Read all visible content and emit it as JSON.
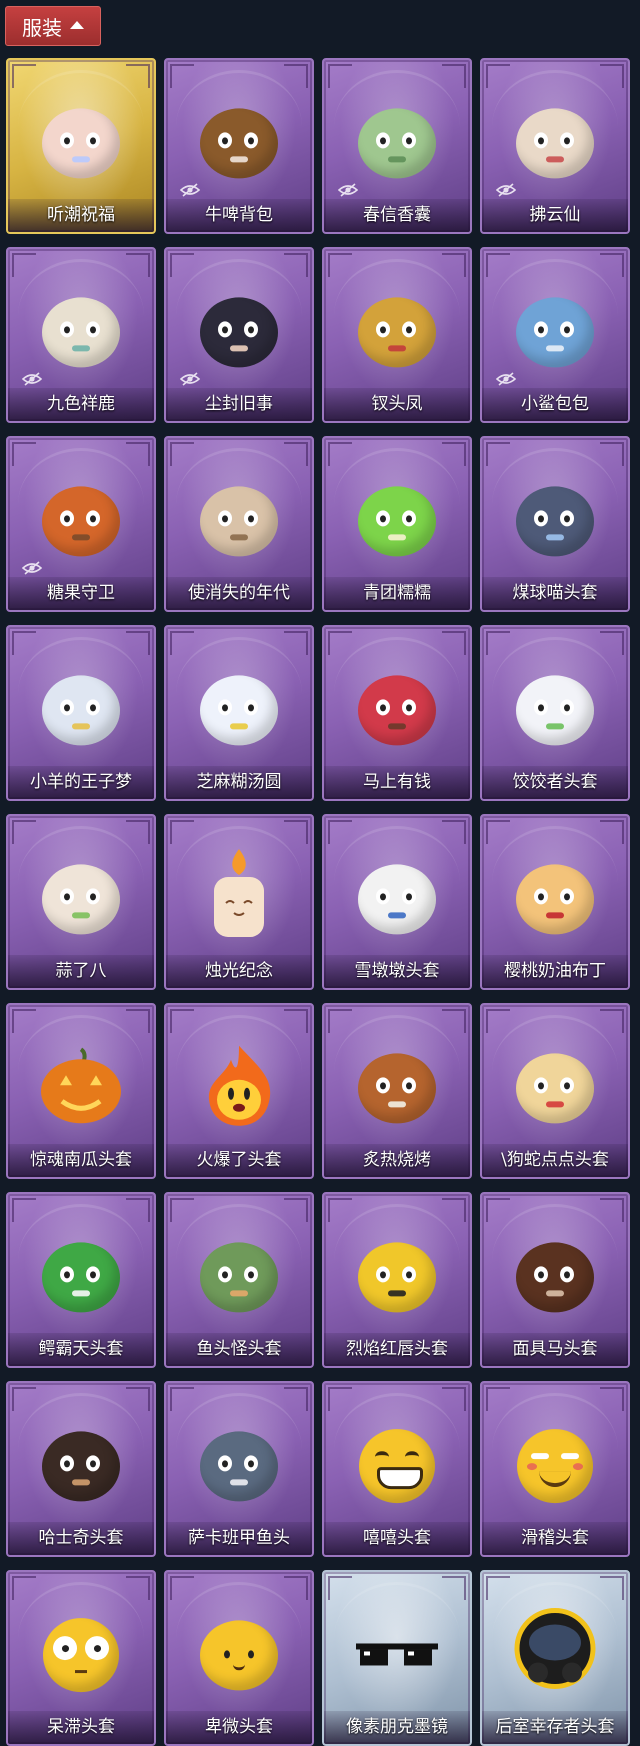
{
  "header": {
    "label": "服装"
  },
  "items": [
    {
      "name": "听潮祝福",
      "frame": "gold",
      "hidden": false,
      "icon": "bust-icon",
      "color": "#f3d6cc",
      "accent": "#b7c9ff"
    },
    {
      "name": "牛啤背包",
      "frame": "purple",
      "hidden": true,
      "icon": "cow-barrel-icon",
      "color": "#8a5a2b",
      "accent": "#f1e4dc"
    },
    {
      "name": "春信香囊",
      "frame": "purple",
      "hidden": true,
      "icon": "sachet-icon",
      "color": "#9fc78f",
      "accent": "#5e8f58"
    },
    {
      "name": "拂云仙",
      "frame": "purple",
      "hidden": true,
      "icon": "fairy-charm-icon",
      "color": "#e9d9c8",
      "accent": "#c94f4f"
    },
    {
      "name": "九色祥鹿",
      "frame": "purple",
      "hidden": true,
      "icon": "deer-icon",
      "color": "#e8e0d0",
      "accent": "#6fb3a8"
    },
    {
      "name": "尘封旧事",
      "frame": "purple",
      "hidden": true,
      "icon": "doll-icon",
      "color": "#2c2a3a",
      "accent": "#f0d2c0"
    },
    {
      "name": "钗头凤",
      "frame": "purple",
      "hidden": false,
      "icon": "phoenix-crown-icon",
      "color": "#d3a23a",
      "accent": "#c23b3b"
    },
    {
      "name": "小鲨包包",
      "frame": "purple",
      "hidden": true,
      "icon": "shark-icon",
      "color": "#6fa3d6",
      "accent": "#e9f0f7"
    },
    {
      "name": "糖果守卫",
      "frame": "purple",
      "hidden": true,
      "icon": "scarecrow-icon",
      "color": "#d4662a",
      "accent": "#7a4a2a"
    },
    {
      "name": "使消失的年代",
      "frame": "purple",
      "hidden": false,
      "icon": "portrait-icon",
      "color": "#d9c2a8",
      "accent": "#8a6a4a"
    },
    {
      "name": "青团糯糯",
      "frame": "purple",
      "hidden": false,
      "icon": "green-blob-icon",
      "color": "#7dd44a",
      "accent": "#f7f2d0"
    },
    {
      "name": "煤球喵头套",
      "frame": "purple",
      "hidden": false,
      "icon": "cat-head-icon",
      "color": "#4e5a78",
      "accent": "#9fc3f0"
    },
    {
      "name": "小羊的王子梦",
      "frame": "purple",
      "hidden": false,
      "icon": "sheep-icon",
      "color": "#dfe6f2",
      "accent": "#e5c04a"
    },
    {
      "name": "芝麻糊汤圆",
      "frame": "purple",
      "hidden": false,
      "icon": "dumpling-icon",
      "color": "#eef2fb",
      "accent": "#e8c93a"
    },
    {
      "name": "马上有钱",
      "frame": "purple",
      "hidden": false,
      "icon": "horse-head-icon",
      "color": "#d23a4a",
      "accent": "#6a3a2a"
    },
    {
      "name": "饺饺者头套",
      "frame": "purple",
      "hidden": false,
      "icon": "cloud-head-icon",
      "color": "#f2f3f8",
      "accent": "#6bbf5a"
    },
    {
      "name": "蒜了八",
      "frame": "purple",
      "hidden": false,
      "icon": "garlic-icon",
      "color": "#efe4d8",
      "accent": "#7cbf5a"
    },
    {
      "name": "烛光纪念",
      "frame": "purple",
      "hidden": false,
      "icon": "candle-icon",
      "color": "#f6e2cc",
      "accent": "#f59a2a"
    },
    {
      "name": "雪墩墩头套",
      "frame": "purple",
      "hidden": false,
      "icon": "snowman-icon",
      "color": "#f2f2f2",
      "accent": "#3a6ac2"
    },
    {
      "name": "樱桃奶油布丁",
      "frame": "purple",
      "hidden": false,
      "icon": "pudding-icon",
      "color": "#f3c37a",
      "accent": "#c2272d"
    },
    {
      "name": "惊魂南瓜头套",
      "frame": "purple",
      "hidden": false,
      "icon": "pumpkin-icon",
      "color": "#e67a1a",
      "accent": "#ffd65a"
    },
    {
      "name": "火爆了头套",
      "frame": "purple",
      "hidden": false,
      "icon": "fire-icon",
      "color": "#f26a1b",
      "accent": "#ffcf3a"
    },
    {
      "name": "炙热烧烤",
      "frame": "purple",
      "hidden": false,
      "icon": "bbq-icon",
      "color": "#b5642e",
      "accent": "#f2efe6"
    },
    {
      "name": "\\狗蛇点点头套",
      "frame": "purple",
      "hidden": false,
      "icon": "dog-snake-icon",
      "color": "#f0d59a",
      "accent": "#d43a3a"
    },
    {
      "name": "鳄霸天头套",
      "frame": "purple",
      "hidden": false,
      "icon": "crocodile-icon",
      "color": "#3fa845",
      "accent": "#f7f7f7"
    },
    {
      "name": "鱼头怪头套",
      "frame": "purple",
      "hidden": false,
      "icon": "fish-mask-icon",
      "color": "#6f9a5a",
      "accent": "#e7a86a"
    },
    {
      "name": "烈焰红唇头套",
      "frame": "purple",
      "hidden": false,
      "icon": "pikachu-icon",
      "color": "#f0c72a",
      "accent": "#222222"
    },
    {
      "name": "面具马头套",
      "frame": "purple",
      "hidden": false,
      "icon": "horse-mask-icon",
      "color": "#5a3220",
      "accent": "#d9c0a8"
    },
    {
      "name": "哈士奇头套",
      "frame": "purple",
      "hidden": false,
      "icon": "husky-icon",
      "color": "#3a2a24",
      "accent": "#d4a070"
    },
    {
      "name": "萨卡班甲鱼头",
      "frame": "purple",
      "hidden": false,
      "icon": "fish-icon",
      "color": "#5a6a80",
      "accent": "#eef0f4"
    },
    {
      "name": "嘻嘻头套",
      "frame": "purple",
      "hidden": false,
      "icon": "grin-emoji-icon",
      "color": "#f6c52a",
      "accent": "#3a2a10"
    },
    {
      "name": "滑稽头套",
      "frame": "purple",
      "hidden": false,
      "icon": "smirk-emoji-icon",
      "color": "#f6c52a",
      "accent": "#e65a5a"
    },
    {
      "name": "呆滞头套",
      "frame": "purple",
      "hidden": false,
      "icon": "dazed-emoji-icon",
      "color": "#f6c52a",
      "accent": "#ffffff"
    },
    {
      "name": "卑微头套",
      "frame": "purple",
      "hidden": false,
      "icon": "humble-emoji-icon",
      "color": "#f6c52a",
      "accent": "#3a2a10"
    },
    {
      "name": "像素朋克墨镜",
      "frame": "blue",
      "hidden": false,
      "icon": "pixel-sunglasses-icon",
      "color": "#111111",
      "accent": "#ffffff"
    },
    {
      "name": "后室幸存者头套",
      "frame": "blue",
      "hidden": false,
      "icon": "gas-mask-icon",
      "color": "#222222",
      "accent": "#f2c21a"
    }
  ]
}
